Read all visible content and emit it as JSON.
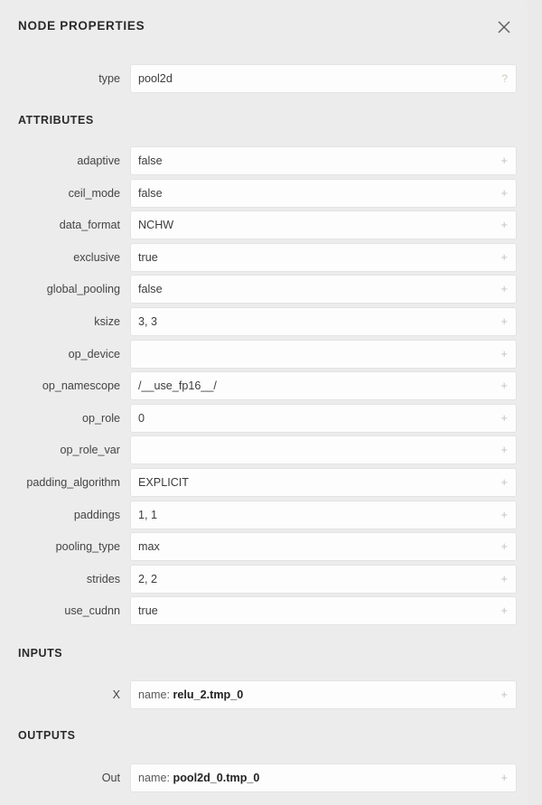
{
  "panel": {
    "title": "NODE PROPERTIES",
    "close_icon": "close-icon",
    "accent_bg": "#ececec",
    "field_bg": "#fdfdfd"
  },
  "type_row": {
    "label": "type",
    "value": "pool2d",
    "affix": "?"
  },
  "sections": {
    "attributes_label": "ATTRIBUTES",
    "inputs_label": "INPUTS",
    "outputs_label": "OUTPUTS"
  },
  "attributes": [
    {
      "label": "adaptive",
      "value": "false",
      "affix": "+"
    },
    {
      "label": "ceil_mode",
      "value": "false",
      "affix": "+"
    },
    {
      "label": "data_format",
      "value": "NCHW",
      "affix": "+"
    },
    {
      "label": "exclusive",
      "value": "true",
      "affix": "+"
    },
    {
      "label": "global_pooling",
      "value": "false",
      "affix": "+"
    },
    {
      "label": "ksize",
      "value": "3, 3",
      "affix": "+"
    },
    {
      "label": "op_device",
      "value": "",
      "affix": "+"
    },
    {
      "label": "op_namescope",
      "value": "/__use_fp16__/",
      "affix": "+"
    },
    {
      "label": "op_role",
      "value": "0",
      "affix": "+"
    },
    {
      "label": "op_role_var",
      "value": "",
      "affix": "+"
    },
    {
      "label": "padding_algorithm",
      "value": "EXPLICIT",
      "affix": "+"
    },
    {
      "label": "paddings",
      "value": "1, 1",
      "affix": "+"
    },
    {
      "label": "pooling_type",
      "value": "max",
      "affix": "+"
    },
    {
      "label": "strides",
      "value": "2, 2",
      "affix": "+"
    },
    {
      "label": "use_cudnn",
      "value": "true",
      "affix": "+"
    }
  ],
  "inputs": [
    {
      "label": "X",
      "name_prefix": "name: ",
      "name_value": "relu_2.tmp_0",
      "affix": "+"
    }
  ],
  "outputs": [
    {
      "label": "Out",
      "name_prefix": "name: ",
      "name_value": "pool2d_0.tmp_0",
      "affix": "+"
    }
  ]
}
